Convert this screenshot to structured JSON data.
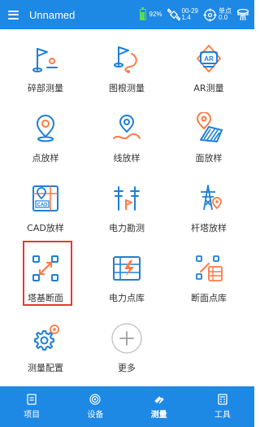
{
  "header": {
    "app_title": "Unnamed",
    "battery": "92%",
    "satellite_top": "00-29",
    "satellite_bottom": "1.4",
    "solution_top": "单点",
    "solution_bottom": "0.0"
  },
  "tools": [
    {
      "label": "碎部测量",
      "icon": "flag-point-icon"
    },
    {
      "label": "图根测量",
      "icon": "flag-path-icon"
    },
    {
      "label": "AR测量",
      "icon": "ar-icon"
    },
    {
      "label": "点放样",
      "icon": "point-stakeout-icon"
    },
    {
      "label": "线放样",
      "icon": "line-stakeout-icon"
    },
    {
      "label": "面放样",
      "icon": "area-stakeout-icon"
    },
    {
      "label": "CAD放样",
      "icon": "cad-icon"
    },
    {
      "label": "电力勘测",
      "icon": "power-survey-icon"
    },
    {
      "label": "杆塔放样",
      "icon": "tower-stakeout-icon"
    },
    {
      "label": "塔基断面",
      "icon": "tower-base-section-icon"
    },
    {
      "label": "电力点库",
      "icon": "power-point-library-icon"
    },
    {
      "label": "断面点库",
      "icon": "section-point-library-icon"
    },
    {
      "label": "测量配置",
      "icon": "settings-gear-icon"
    },
    {
      "label": "更多",
      "icon": "plus-icon"
    }
  ],
  "bottom_nav": [
    {
      "label": "项目",
      "icon": "project-icon",
      "active": false
    },
    {
      "label": "设备",
      "icon": "device-icon",
      "active": false
    },
    {
      "label": "测量",
      "icon": "measure-icon",
      "active": true
    },
    {
      "label": "工具",
      "icon": "tools-icon",
      "active": false
    }
  ],
  "colors": {
    "primary": "#1e88e5",
    "icon_blue": "#1e7fd6",
    "icon_orange": "#ff7a45",
    "highlight": "#e53935",
    "battery": "#56e04a"
  }
}
